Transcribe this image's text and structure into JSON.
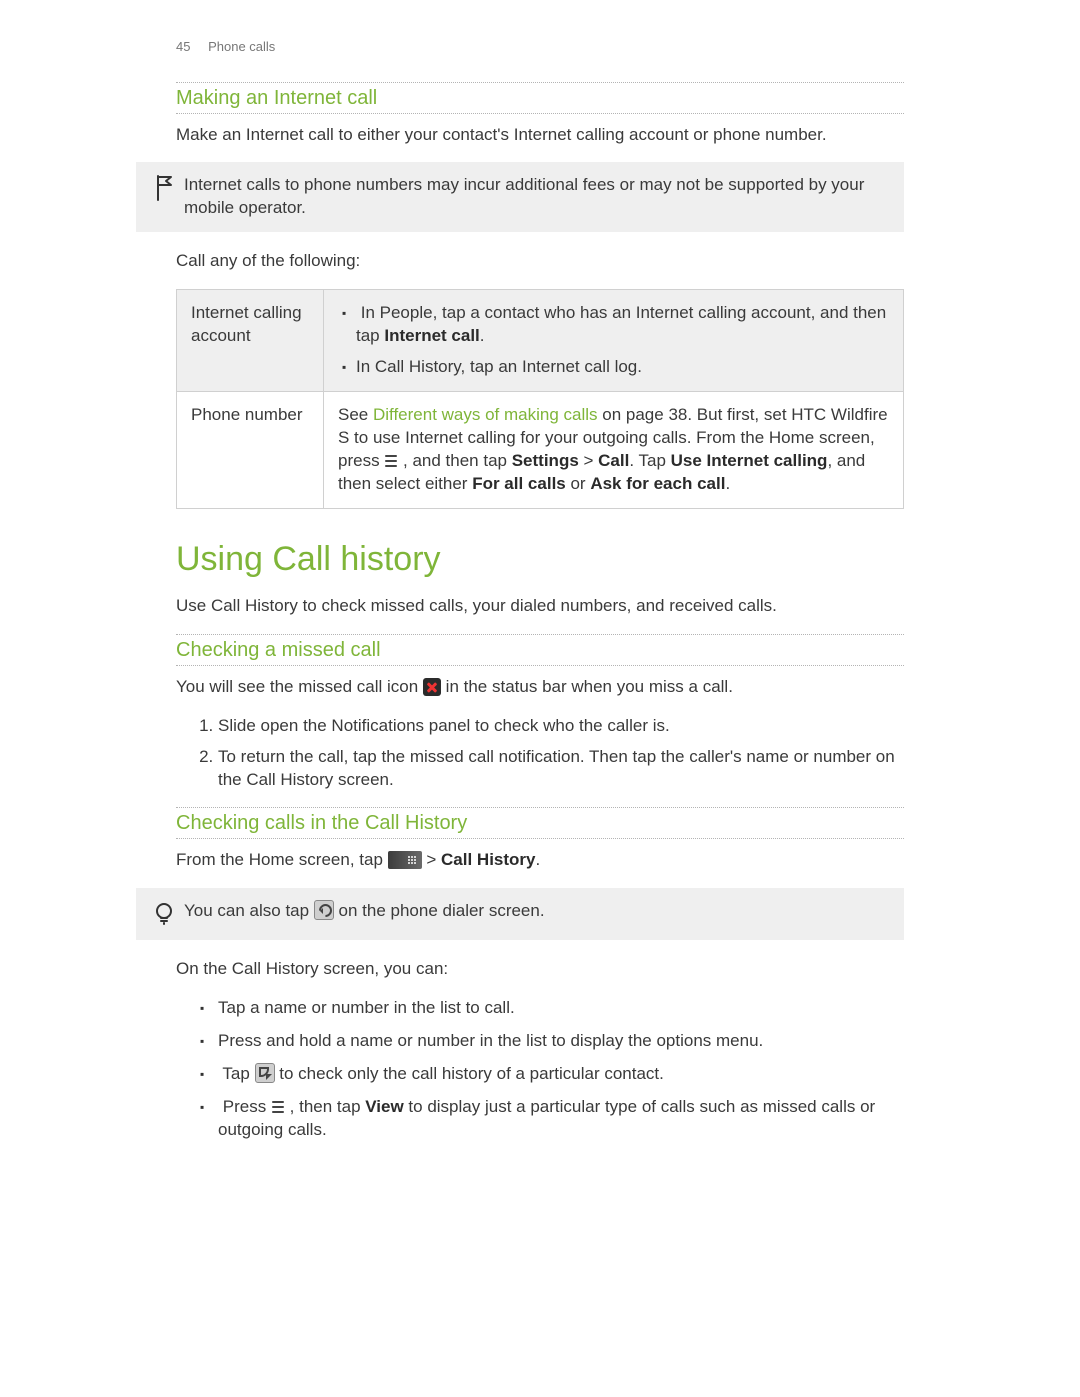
{
  "header": {
    "page_number": "45",
    "section": "Phone calls"
  },
  "s1": {
    "title": "Making an Internet call",
    "intro": "Make an Internet call to either your contact's Internet calling account or phone number.",
    "warning": "Internet calls to phone numbers may incur additional fees or may not be supported by your mobile operator.",
    "lead": "Call any of the following:",
    "row1_label": "Internet calling account",
    "row1_b1a": "In People, tap a contact who has an Internet calling account, and then tap ",
    "row1_b1b": "Internet call",
    "row1_b1c": ".",
    "row1_b2": "In Call History, tap an Internet call log.",
    "row2_label": "Phone number",
    "row2_a": "See ",
    "row2_link": "Different ways of making calls",
    "row2_b": " on page 38. But first, set HTC Wildfire S to use Internet calling for your outgoing calls. From the Home screen, press ",
    "row2_c": " , and then tap ",
    "row2_d": "Settings",
    "row2_gt": " > ",
    "row2_e": "Call",
    "row2_f": ". Tap ",
    "row2_g": "Use Internet calling",
    "row2_h": ", and then select either ",
    "row2_i": "For all calls",
    "row2_j": " or ",
    "row2_k": "Ask for each call",
    "row2_l": "."
  },
  "s2": {
    "title": "Using Call history",
    "intro": "Use Call History to check missed calls, your dialed numbers, and received calls."
  },
  "s3": {
    "title": "Checking a missed call",
    "line_a": "You will see the missed call icon ",
    "line_b": " in the status bar when you miss a call.",
    "step1": "Slide open the Notifications panel to check who the caller is.",
    "step2": "To return the call, tap the missed call notification. Then tap the caller's name or number on the Call History screen."
  },
  "s4": {
    "title": "Checking calls in the Call History",
    "line_a": "From the Home screen, tap ",
    "line_gt": " > ",
    "line_b": "Call History",
    "line_c": ".",
    "tip_a": "You can also tap ",
    "tip_b": " on the phone dialer screen.",
    "lead": "On the Call History screen, you can:",
    "b1": "Tap a name or number in the list to call.",
    "b2": "Press and hold a name or number in the list to display the options menu.",
    "b3_a": "Tap ",
    "b3_b": " to check only the call history of a particular contact.",
    "b4_a": "Press ",
    "b4_b": " , then tap ",
    "b4_c": "View",
    "b4_d": " to display just a particular type of calls such as missed calls or outgoing calls."
  }
}
